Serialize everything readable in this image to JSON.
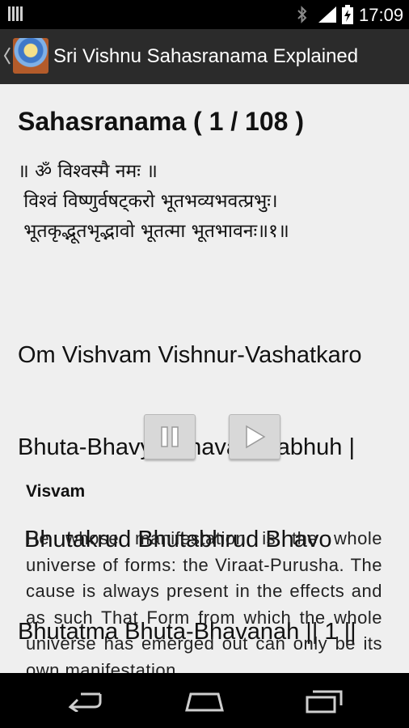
{
  "status_bar": {
    "time": "17:09",
    "icons": [
      "notification-bars-icon",
      "bluetooth-icon",
      "signal-icon",
      "battery-charging-icon"
    ]
  },
  "action_bar": {
    "title": "Sri Vishnu Sahasranama Explained",
    "icons": [
      "back-chevron-icon",
      "app-logo-icon"
    ]
  },
  "content": {
    "heading": "Sahasranama ( 1 / 108 )",
    "sanskrit_lines": [
      "॥ ॐ विश्वस्मै नमः ॥",
      " विश्वं विष्णुर्वषट्करो भूतभव्यभवत्प्रभुः।",
      " भूतकृद्भूतभृद्भावो भूतत्मा भूतभावनः॥१॥"
    ],
    "transliteration_lines": [
      "Om Vishvam Vishnur-Vashatkaro",
      "Bhuta-Bhavya-Bhavat-Prabhuh |",
      " Bhutakrud Bhutabhrud Bhavo",
      "Bhutatma Bhuta-Bhavanah || 1 ||"
    ],
    "term": "Visvam",
    "explanation": "He whose manifestation is the whole universe of forms: the Viraat-Purusha. The cause is always present in the effects and as such That Form from which the whole universe has emerged out can only be its own manifestation."
  },
  "controls": {
    "icons": [
      "pause-icon",
      "play-icon"
    ]
  },
  "nav_bar": {
    "icons": [
      "back-icon",
      "home-icon",
      "recent-apps-icon"
    ]
  }
}
